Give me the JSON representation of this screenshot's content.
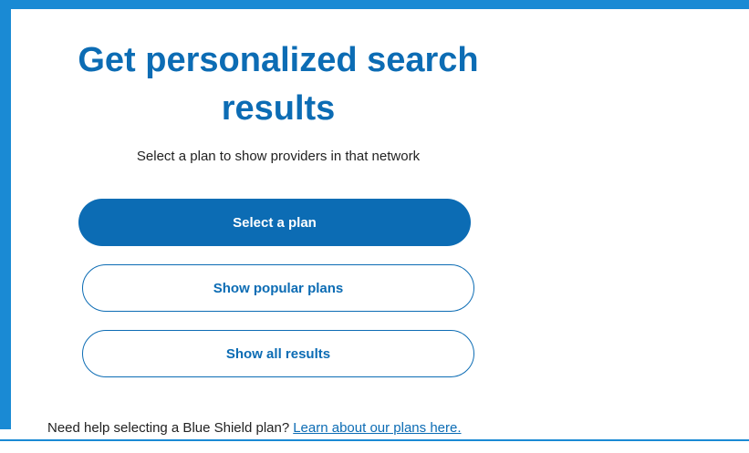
{
  "panel": {
    "title": "Get personalized search results",
    "subtitle": "Select a plan to show providers in that network"
  },
  "actions": {
    "select_plan": "Select a plan",
    "show_popular": "Show popular plans",
    "show_all": "Show all results"
  },
  "help": {
    "text": "Need help selecting a Blue Shield plan?",
    "link": "Learn about our plans here."
  },
  "colors": {
    "brand_blue": "#0c6cb4",
    "border_blue": "#1a8ad4",
    "text": "#222222"
  }
}
